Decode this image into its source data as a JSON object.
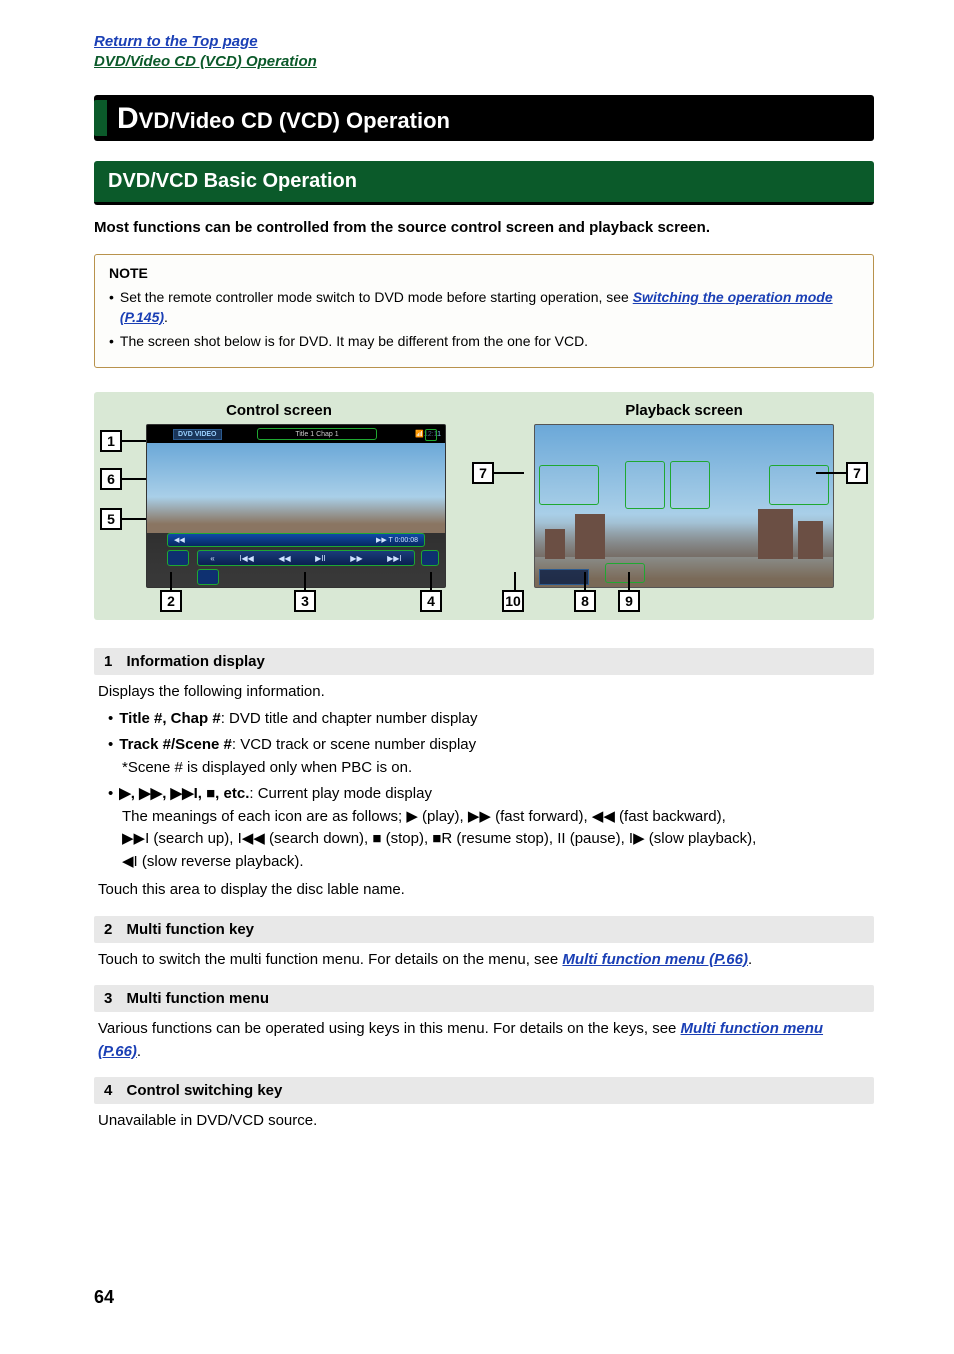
{
  "header": {
    "return_link": "Return to the Top page",
    "breadcrumb": "DVD/Video CD (VCD) Operation"
  },
  "main_title": {
    "big_letter": "D",
    "rest": "VD/Video CD (VCD) Operation"
  },
  "section_title": "DVD/VCD Basic Operation",
  "intro": "Most functions can be controlled from the source control screen and playback screen.",
  "note": {
    "title": "NOTE",
    "item1_pre": "Set the remote controller mode switch to DVD mode before starting operation, see ",
    "item1_link": "Switching the operation mode (P.145)",
    "item1_post": ".",
    "item2": "The screen shot below is for DVD. It may be different from the one for VCD."
  },
  "diagram": {
    "left_title": "Control screen",
    "right_title": "Playback screen",
    "control_screen": {
      "clock": "12:11",
      "dvd_label": "DVD VIDEO",
      "title_chap": "Title 1 Chap 1",
      "status_left": "◀◀",
      "status_right": "▶▶  T 0:00:08"
    },
    "callouts": {
      "c1": "1",
      "c2": "2",
      "c3": "3",
      "c4": "4",
      "c5": "5",
      "c6": "6",
      "c7": "7",
      "c8": "8",
      "c9": "9",
      "c10": "10"
    }
  },
  "defs": {
    "d1": {
      "num": "1",
      "title": "Information display",
      "intro": "Displays the following information.",
      "b1_bold": "Title #, Chap #",
      "b1_rest": ": DVD title and chapter number display",
      "b2_bold": "Track #/Scene #",
      "b2_rest": ": VCD track or scene number display",
      "b2_note": "*Scene # is displayed only when PBC is on.",
      "b3_bold": "▶, ▶▶, ▶▶I, ■, etc.",
      "b3_rest": ": Current play mode display",
      "icons_pre": "The meanings of each icon are as follows; ",
      "icons_line1": "▶ (play), ▶▶ (fast forward), ◀◀ (fast backward),",
      "icons_line2": "▶▶I (search up), I◀◀ (search down), ■ (stop), ■R (resume stop), II (pause), I▶ (slow playback),",
      "icons_line3": "◀I (slow reverse playback).",
      "outro": "Touch this area to display the disc lable name."
    },
    "d2": {
      "num": "2",
      "title": "Multi function key",
      "text_pre": "Touch to switch the multi function menu. For details on the menu, see ",
      "link": "Multi function menu (P.66)",
      "text_post": "."
    },
    "d3": {
      "num": "3",
      "title": "Multi function menu",
      "text_pre": "Various functions can be operated using keys in this menu. For details on the keys, see ",
      "link": "Multi function menu (P.66)",
      "text_post": "."
    },
    "d4": {
      "num": "4",
      "title": "Control switching key",
      "text": "Unavailable in DVD/VCD source."
    }
  },
  "page_number": "64"
}
